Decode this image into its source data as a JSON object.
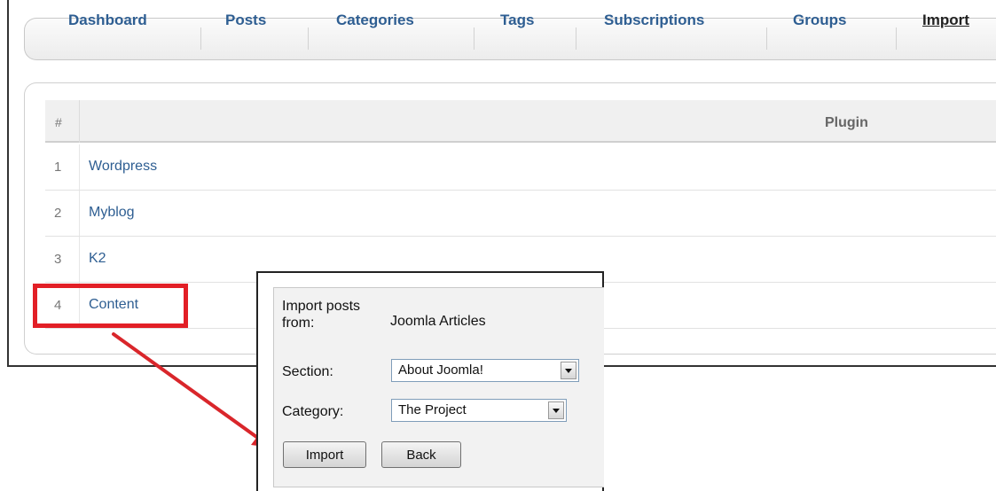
{
  "nav": {
    "items": [
      {
        "label": "Dashboard"
      },
      {
        "label": "Posts"
      },
      {
        "label": "Categories"
      },
      {
        "label": "Tags"
      },
      {
        "label": "Subscriptions"
      },
      {
        "label": "Groups"
      },
      {
        "label": "Import",
        "active": true
      }
    ]
  },
  "table": {
    "headers": {
      "num": "#",
      "plugin": "Plugin"
    },
    "rows": [
      {
        "num": "1",
        "name": "Wordpress"
      },
      {
        "num": "2",
        "name": "Myblog"
      },
      {
        "num": "3",
        "name": "K2"
      },
      {
        "num": "4",
        "name": "Content"
      }
    ]
  },
  "popup": {
    "import_from_label": "Import posts from:",
    "import_from_value": "Joomla Articles",
    "section_label": "Section:",
    "section_value": "About Joomla!",
    "category_label": "Category:",
    "category_value": "The Project",
    "import_button": "Import",
    "back_button": "Back"
  },
  "colors": {
    "link": "#2e5e92",
    "highlight": "#e21f26",
    "arrow": "#d9262b"
  }
}
